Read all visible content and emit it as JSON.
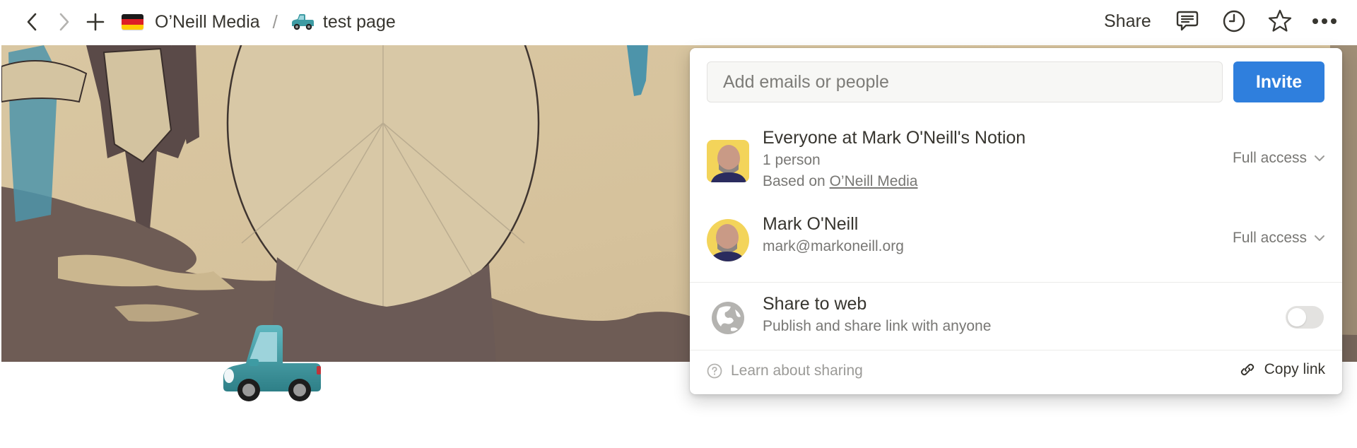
{
  "topbar": {
    "breadcrumb": [
      {
        "label": "O’Neill Media",
        "icon": "german-flag-emoji"
      },
      {
        "label": "test page",
        "icon": "pickup-truck-emoji"
      }
    ],
    "separator": "/",
    "share_label": "Share",
    "icons": [
      "back-arrow",
      "forward-arrow",
      "plus",
      "comment",
      "clock-history",
      "star",
      "more-horizontal"
    ]
  },
  "share_popover": {
    "invite_placeholder": "Add emails or people",
    "invite_value": "",
    "invite_button": "Invite",
    "members": [
      {
        "name": "Everyone at Mark O'Neill's Notion",
        "count": "1 person",
        "based_on_prefix": "Based on",
        "based_on_link": "O’Neill Media",
        "access": "Full access"
      },
      {
        "name": "Mark O'Neill",
        "email": "mark@markoneill.org",
        "access": "Full access"
      }
    ],
    "web": {
      "title": "Share to web",
      "subtitle": "Publish and share link with anyone",
      "enabled": false
    },
    "footer": {
      "learn_label": "Learn about sharing",
      "copy_label": "Copy link"
    }
  },
  "colors": {
    "accent": "#2f7fdd",
    "text": "#37352f",
    "muted": "#787774",
    "toggle_off": "#e3e2e0",
    "cover_paper": "#d8c5a0",
    "cover_shadow": "#6e5c55",
    "car_teal": "#3e9ba3"
  }
}
